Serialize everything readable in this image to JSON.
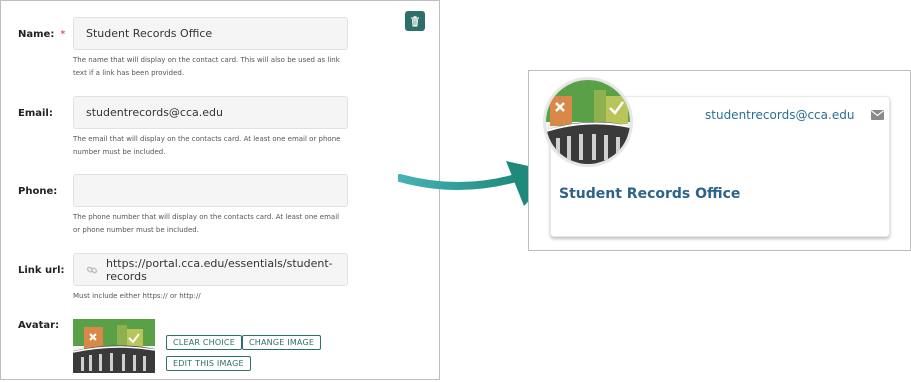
{
  "form": {
    "name": {
      "label": "Name:",
      "required_mark": "*",
      "value": "Student Records Office",
      "help": "The name that will display on the contact card. This will also be used as link text if a link has been provided."
    },
    "email": {
      "label": "Email:",
      "value": "studentrecords@cca.edu",
      "help": "The email that will display on the contacts card. At least one email or phone number must be included."
    },
    "phone": {
      "label": "Phone:",
      "value": "",
      "help": "The phone number that will display on the contacts card. At least one email or phone number must be included."
    },
    "link": {
      "label": "Link url:",
      "value": "https://portal.cca.edu/essentials/student-records",
      "help": "Must include either https:// or http://"
    },
    "avatar": {
      "label": "Avatar:",
      "clear_label": "CLEAR CHOICE",
      "change_label": "CHANGE IMAGE",
      "edit_label": "EDIT THIS IMAGE"
    },
    "delete_icon": "trash-icon"
  },
  "preview": {
    "email": "studentrecords@cca.edu",
    "name": "Student Records Office",
    "mail_icon": "envelope-icon"
  },
  "colors": {
    "accent": "#2f6f6b",
    "name_text": "#2c6388",
    "email_text": "#2a6f91",
    "arrow_start": "#48b1b6",
    "arrow_end": "#1f8a7c"
  }
}
